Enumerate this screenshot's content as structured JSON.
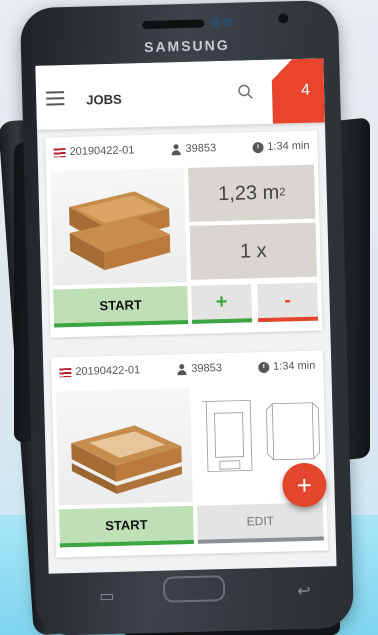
{
  "device": {
    "brand": "SAMSUNG"
  },
  "header": {
    "title": "JOBS",
    "badge_count": "4"
  },
  "jobs": [
    {
      "order_id": "20190422-01",
      "user_count": "39853",
      "duration": "1:34 min",
      "area_value": "1,23 m",
      "area_unit_exp": "2",
      "quantity": "1 x",
      "start_label": "START",
      "plus_label": "+",
      "minus_label": "-"
    },
    {
      "order_id": "20190422-01",
      "user_count": "39853",
      "duration": "1:34 min",
      "start_label": "START",
      "edit_label": "EDIT"
    }
  ],
  "fab": {
    "label": "+"
  },
  "colors": {
    "accent": "#e4462d",
    "start_green": "#3aa541",
    "start_bg": "#bfe0b7"
  }
}
